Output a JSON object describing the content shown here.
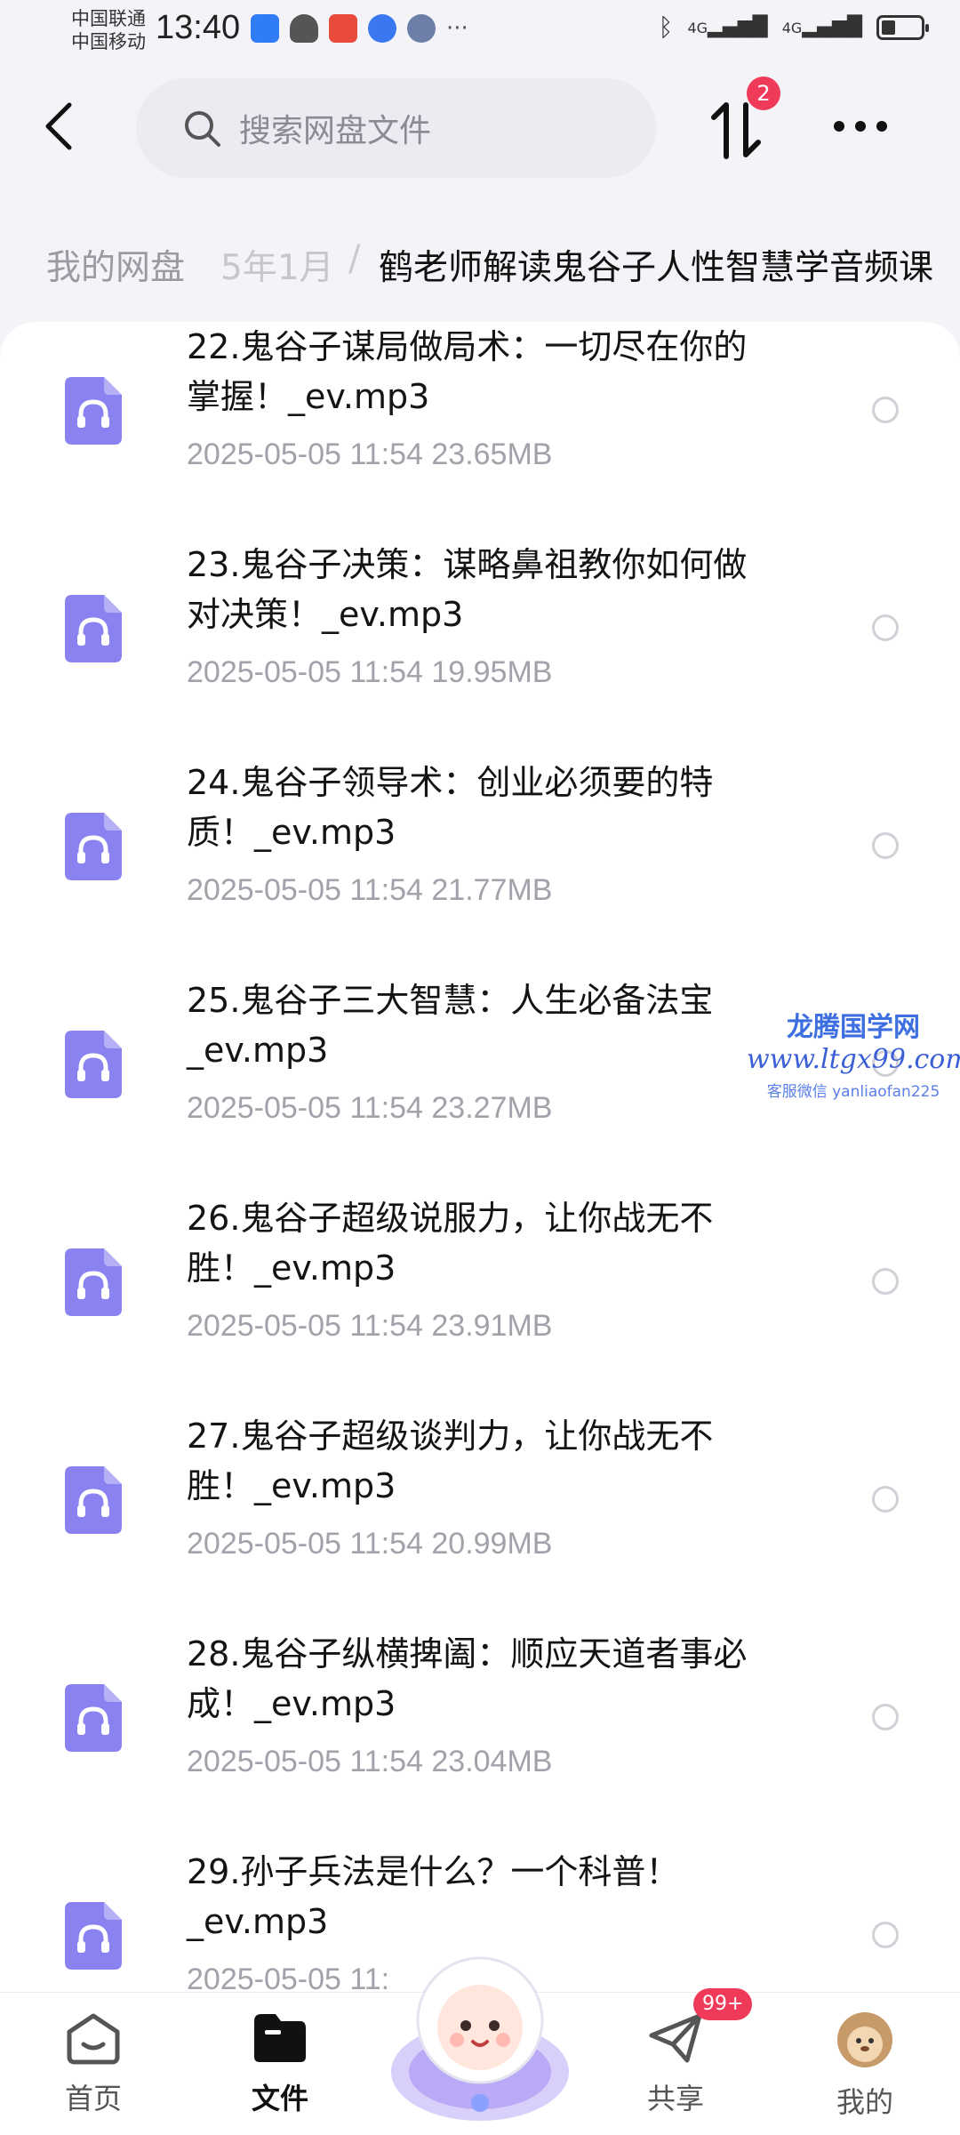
{
  "status": {
    "carrier1": "中国联通",
    "carrier2": "中国移动",
    "time": "13:40",
    "net1": "4G",
    "net2": "4G",
    "battery_level": 0.35
  },
  "header": {
    "search_placeholder": "搜索网盘文件",
    "transfer_badge": "2"
  },
  "breadcrumb": {
    "home": "我的网盘",
    "partial": "5年1月",
    "separator": "/",
    "current": "鹤老师解读鬼谷子人性智慧学音频课"
  },
  "files": [
    {
      "title_line1": "22.鬼谷子谋局做局术：一切尽在你的",
      "title_line2": "掌握！_ev.mp3",
      "meta": "2025-05-05  11:54  23.65MB"
    },
    {
      "title_line1": "23.鬼谷子决策：谋略鼻祖教你如何做",
      "title_line2": "对决策！_ev.mp3",
      "meta": "2025-05-05  11:54  19.95MB"
    },
    {
      "title_line1": "24.鬼谷子领导术：创业必须要的特",
      "title_line2": "质！_ev.mp3",
      "meta": "2025-05-05  11:54  21.77MB"
    },
    {
      "title_line1": "25.鬼谷子三大智慧：人生必备法宝",
      "title_line2": "_ev.mp3",
      "meta": "2025-05-05  11:54  23.27MB"
    },
    {
      "title_line1": "26.鬼谷子超级说服力，让你战无不",
      "title_line2": "胜！_ev.mp3",
      "meta": "2025-05-05  11:54  23.91MB"
    },
    {
      "title_line1": "27.鬼谷子超级谈判力，让你战无不",
      "title_line2": "胜！_ev.mp3",
      "meta": "2025-05-05  11:54  20.99MB"
    },
    {
      "title_line1": "28.鬼谷子纵横捭阖：顺应天道者事必",
      "title_line2": "成！_ev.mp3",
      "meta": "2025-05-05  11:54  23.04MB"
    },
    {
      "title_line1": "29.孙子兵法是什么？一个科普！",
      "title_line2": "_ev.mp3",
      "meta": "2025-05-05  11:"
    }
  ],
  "watermark": {
    "line1": "龙腾国学网",
    "line2": "www.ltgx99.com",
    "line3": "客服微信 yanliaofan225"
  },
  "nav": {
    "home": "首页",
    "files": "文件",
    "share": "共享",
    "mine": "我的",
    "share_badge": "99+"
  },
  "colors": {
    "accent": "#8a82f0",
    "badge": "#ef3b59",
    "background": "#f4f4f8"
  }
}
